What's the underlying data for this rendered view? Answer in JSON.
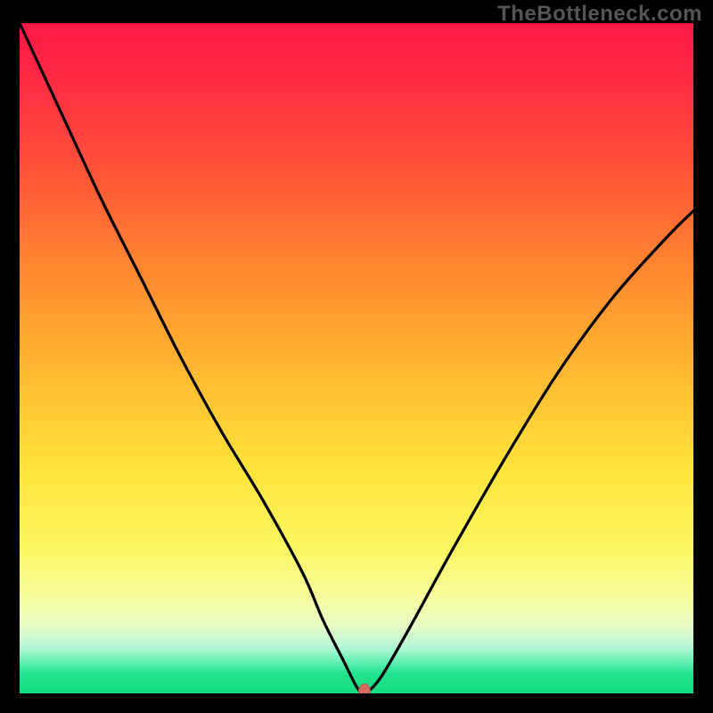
{
  "watermark": "TheBottleneck.com",
  "colors": {
    "frame": "#000000",
    "curve": "#000000",
    "marker": "#d46a5e",
    "gradient_top": "#ff1846",
    "gradient_bottom": "#14db7f"
  },
  "chart_data": {
    "type": "line",
    "title": "",
    "xlabel": "",
    "ylabel": "",
    "xlim": [
      0,
      100
    ],
    "ylim": [
      0,
      100
    ],
    "x": [
      0,
      6,
      12,
      18,
      24,
      30,
      36,
      42,
      45,
      48,
      50,
      51,
      52,
      54,
      58,
      64,
      72,
      80,
      88,
      96,
      100
    ],
    "values": [
      100,
      87,
      74,
      62,
      50,
      39,
      29,
      18,
      11,
      5,
      1,
      0,
      0.5,
      3,
      10,
      21,
      35,
      48,
      59,
      68,
      72
    ],
    "marker": {
      "x": 51.2,
      "y": 0.2
    },
    "notes": "V-shaped bottleneck curve on rainbow gradient; y is bottleneck percentage (0 at bottom = optimal)."
  }
}
